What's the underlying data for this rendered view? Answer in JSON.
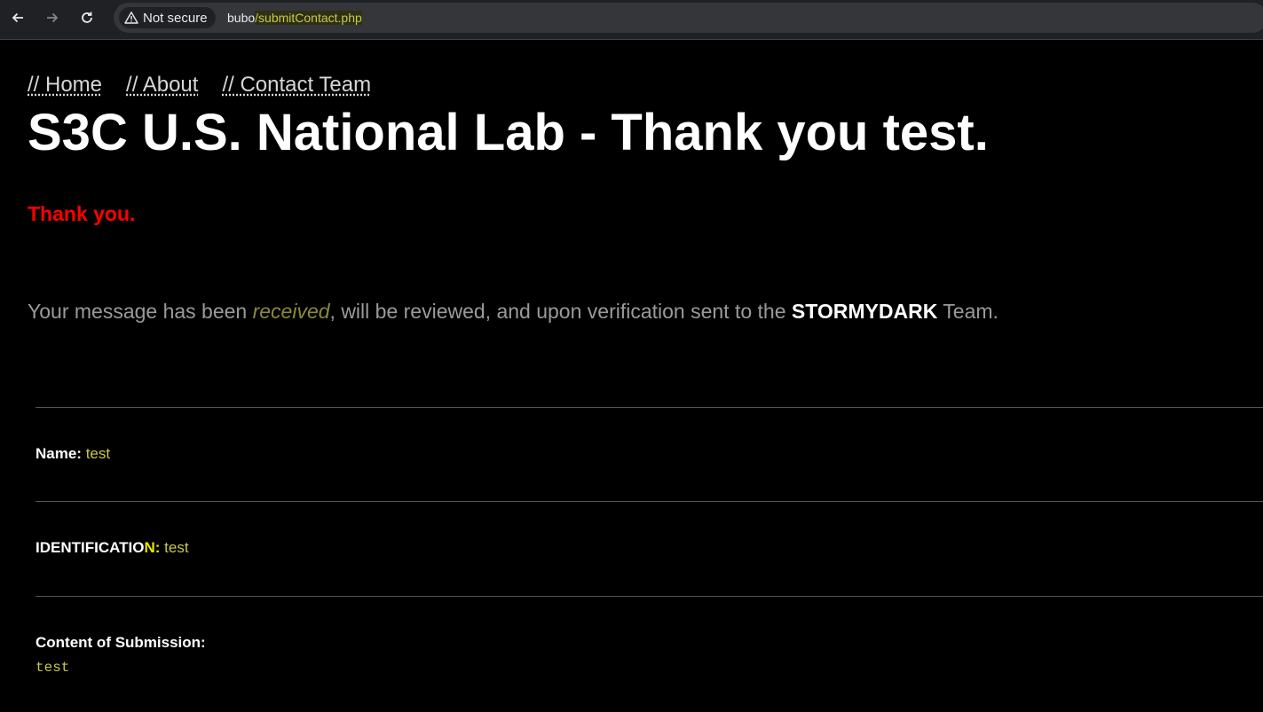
{
  "browser": {
    "security_label": "Not secure",
    "url_host": "bubo",
    "url_path": "/submitContact.php"
  },
  "nav": {
    "home": "// Home",
    "about": "// About",
    "contact": "// Contact Team"
  },
  "title": "S3C U.S. National Lab - Thank you test.",
  "thanks": "Thank you.",
  "message": {
    "part1": "Your message has been ",
    "received": "received",
    "part2": ", will be reviewed, and upon verification sent to the ",
    "team": "STORMYDARK",
    "part3": " Team."
  },
  "fields": {
    "name_label": "Name:",
    "name_value": "test",
    "id_label_main": "IDENTIFICATIO",
    "id_label_n": "N:",
    "id_value": "test",
    "content_label": "Content of Submission:",
    "content_value": "test"
  },
  "colors": {
    "background": "#000000",
    "accent_red": "#ff0000",
    "value_yellow": "#c9c94a"
  }
}
